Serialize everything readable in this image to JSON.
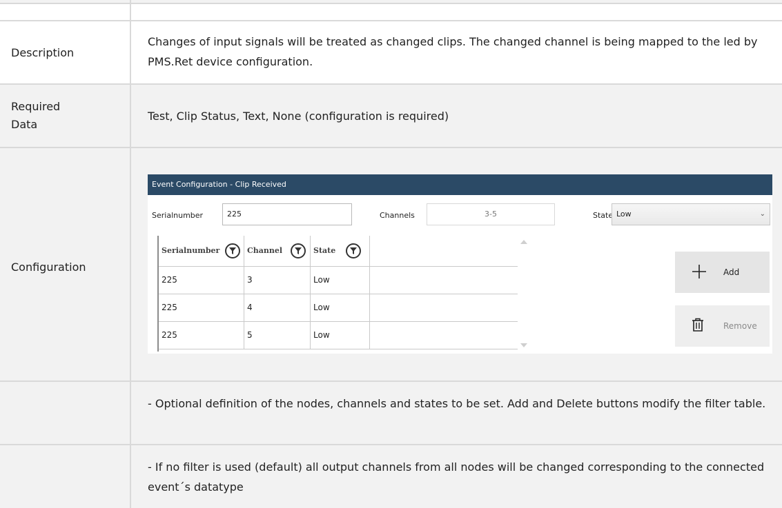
{
  "rows": {
    "description": {
      "label": "Description",
      "text": "Changes of input signals will be treated as changed clips. The changed channel is being mapped to the led by PMS.Ret device configuration."
    },
    "required_data": {
      "label_line1": "Required",
      "label_line2": "Data",
      "text": "Test, Clip Status, Text, None (configuration is required)"
    },
    "configuration": {
      "label": "Configuration"
    },
    "note1": {
      "text": "- Optional definition of the nodes, channels and states to be set. Add and Delete buttons modify the filter table."
    },
    "note2": {
      "text": "- If no filter is used (default) all output channels from all nodes will be changed corresponding to the connected event´s datatype"
    }
  },
  "dialog": {
    "title": "Event Configuration - Clip Received",
    "serial_label": "Serialnumber",
    "serial_value": "225",
    "channels_label": "Channels",
    "channels_value": "3-5",
    "state_label": "State",
    "state_value": "Low",
    "grid": {
      "headers": [
        "Serialnumber",
        "Channel",
        "State"
      ],
      "rows": [
        [
          "225",
          "3",
          "Low"
        ],
        [
          "225",
          "4",
          "Low"
        ],
        [
          "225",
          "5",
          "Low"
        ]
      ]
    },
    "add_label": "Add",
    "remove_label": "Remove"
  },
  "colors": {
    "dialog_title_bg": "#2b4a66",
    "row_shade": "#f2f2f2",
    "border": "#d9d9d9"
  }
}
